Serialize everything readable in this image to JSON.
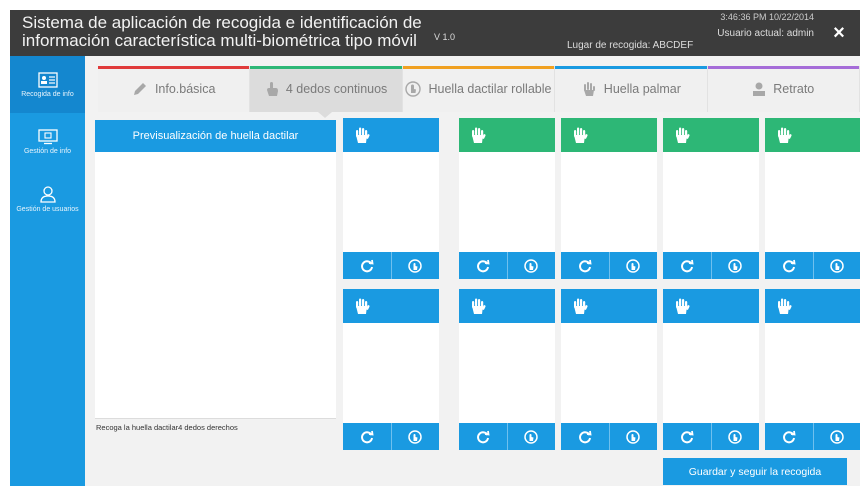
{
  "header": {
    "title_line1": "Sistema de aplicación de recogida e identificación de",
    "title_line2": "información característica multi-biométrica tipo móvil",
    "version": "V 1.0",
    "location": "Lugar de recogida: ABCDEF",
    "time": "3:46:36 PM 10/22/2014",
    "user": "Usuario actual: admin",
    "close_icon": "×"
  },
  "sidebar": {
    "items": [
      {
        "label": "Recogida de info",
        "icon": "id-card-icon",
        "active": true
      },
      {
        "label": "Gestión de info",
        "icon": "monitor-icon",
        "active": false
      },
      {
        "label": "Gestión de usuarios",
        "icon": "user-icon",
        "active": false
      }
    ]
  },
  "tabs": [
    {
      "label": "Info.básica",
      "icon": "pencil-icon",
      "color": "#e03a3a"
    },
    {
      "label": "4 dedos continuos",
      "icon": "pointing-hand-icon",
      "color": "#2db776",
      "active": true
    },
    {
      "label": "Huella dactilar rollable",
      "icon": "rolled-finger-icon",
      "color": "#f0a020"
    },
    {
      "label": "Huella palmar",
      "icon": "palm-icon",
      "color": "#1a9ae1"
    },
    {
      "label": "Retrato",
      "icon": "person-icon",
      "color": "#a56cd8"
    }
  ],
  "preview": {
    "title": "Previsualización de huella dactilar",
    "hint": "Recoga la huella dactilar4 dedos derechos"
  },
  "save_button": "Guardar y seguir la recogida",
  "colors": {
    "accent": "#1a9ae1",
    "captured": "#2db776",
    "header": "#3c3c3c"
  }
}
